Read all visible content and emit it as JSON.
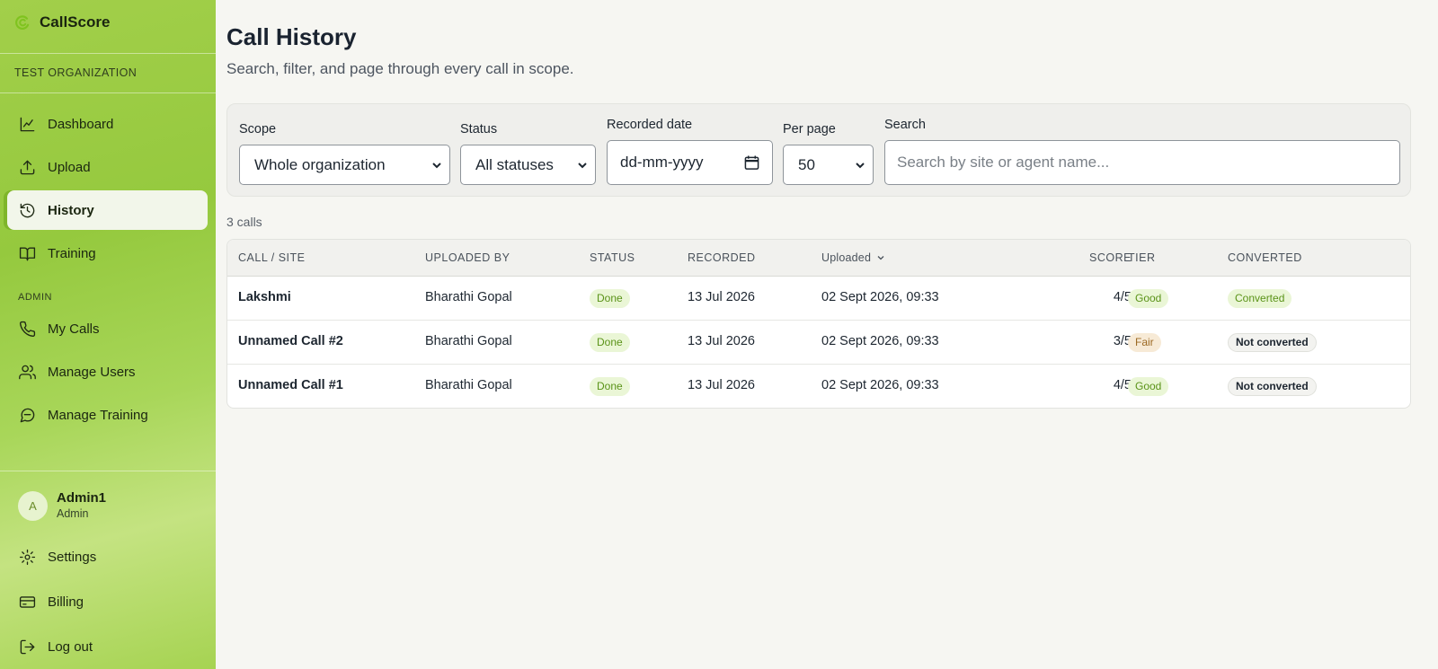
{
  "app": {
    "name": "CallScore"
  },
  "sidebar": {
    "org_name": "TEST ORGANIZATION",
    "nav": [
      {
        "label": "Dashboard",
        "icon": "chart-line-icon"
      },
      {
        "label": "Upload",
        "icon": "upload-icon"
      },
      {
        "label": "History",
        "icon": "history-icon",
        "active": true
      },
      {
        "label": "Training",
        "icon": "book-icon"
      }
    ],
    "admin_section_label": "ADMIN",
    "admin_nav": [
      {
        "label": "My Calls",
        "icon": "phone-icon"
      },
      {
        "label": "Manage Users",
        "icon": "users-icon"
      },
      {
        "label": "Manage Training",
        "icon": "message-circle-icon"
      }
    ],
    "user": {
      "initial": "A",
      "name": "Admin1",
      "role": "Admin"
    },
    "footer_nav": [
      {
        "label": "Settings",
        "icon": "gear-icon"
      },
      {
        "label": "Billing",
        "icon": "credit-card-icon"
      },
      {
        "label": "Log out",
        "icon": "logout-icon"
      }
    ]
  },
  "page": {
    "title": "Call History",
    "subtitle": "Search, filter, and page through every call in scope."
  },
  "filters": {
    "scope": {
      "label": "Scope",
      "value": "Whole organization"
    },
    "status": {
      "label": "Status",
      "value": "All statuses"
    },
    "recorded_date": {
      "label": "Recorded date",
      "placeholder": "dd-mm-yyyy"
    },
    "per_page": {
      "label": "Per page",
      "value": "50"
    },
    "search": {
      "label": "Search",
      "placeholder": "Search by site or agent name..."
    }
  },
  "results": {
    "count_text": "3 calls"
  },
  "table": {
    "columns": {
      "call_site": "CALL / SITE",
      "uploaded_by": "UPLOADED BY",
      "status": "STATUS",
      "recorded": "RECORDED",
      "uploaded": "Uploaded",
      "score": "SCORE",
      "tier": "TIER",
      "converted": "CONVERTED"
    },
    "rows": [
      {
        "call": "Lakshmi",
        "uploaded_by": "Bharathi Gopal",
        "status": "Done",
        "recorded": "13 Jul 2026",
        "uploaded": "02 Sept 2026, 09:33",
        "score": "4/5",
        "tier": "Good",
        "converted": "Converted"
      },
      {
        "call": "Unnamed Call #2",
        "uploaded_by": "Bharathi Gopal",
        "status": "Done",
        "recorded": "13 Jul 2026",
        "uploaded": "02 Sept 2026, 09:33",
        "score": "3/5",
        "tier": "Fair",
        "converted": "Not converted"
      },
      {
        "call": "Unnamed Call #1",
        "uploaded_by": "Bharathi Gopal",
        "status": "Done",
        "recorded": "13 Jul 2026",
        "uploaded": "02 Sept 2026, 09:33",
        "score": "4/5",
        "tier": "Good",
        "converted": "Not converted"
      }
    ]
  },
  "colors": {
    "accent_green": "#9bce3f",
    "badge_green_text": "#5a9318",
    "badge_fair_text": "#9c6a24"
  }
}
